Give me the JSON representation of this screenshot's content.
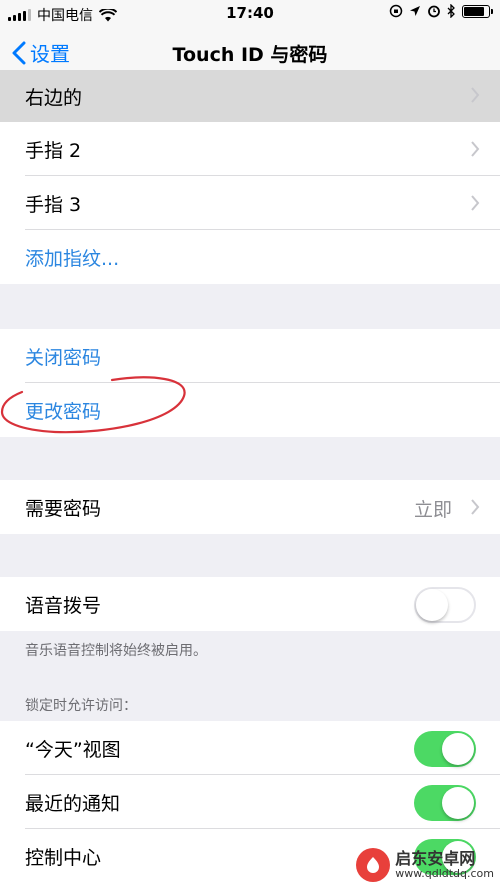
{
  "status_bar": {
    "carrier": "中国电信",
    "time": "17:40",
    "battery_level": 0.9
  },
  "nav": {
    "back_label": "设置",
    "title": "Touch ID 与密码"
  },
  "fingerprints": {
    "items": [
      {
        "label": "右边的"
      },
      {
        "label": "手指 2"
      },
      {
        "label": "手指 3"
      }
    ],
    "add_label": "添加指纹..."
  },
  "passcode": {
    "turn_off_label": "关闭密码",
    "change_label": "更改密码"
  },
  "require": {
    "label": "需要密码",
    "value": "立即"
  },
  "voice_dial": {
    "label": "语音拨号",
    "enabled": false,
    "footnote": "音乐语音控制将始终被启用。"
  },
  "locked_access": {
    "header": "锁定时允许访问：",
    "items": [
      {
        "label": "“今天”视图",
        "enabled": true
      },
      {
        "label": "最近的通知",
        "enabled": true
      },
      {
        "label": "控制中心",
        "enabled": true
      }
    ]
  },
  "watermark": {
    "name": "启东安卓网",
    "url": "www.qdldtdq.com"
  },
  "colors": {
    "accent": "#007aff",
    "toggle_on": "#4cd964",
    "annotation": "#d8323a"
  }
}
